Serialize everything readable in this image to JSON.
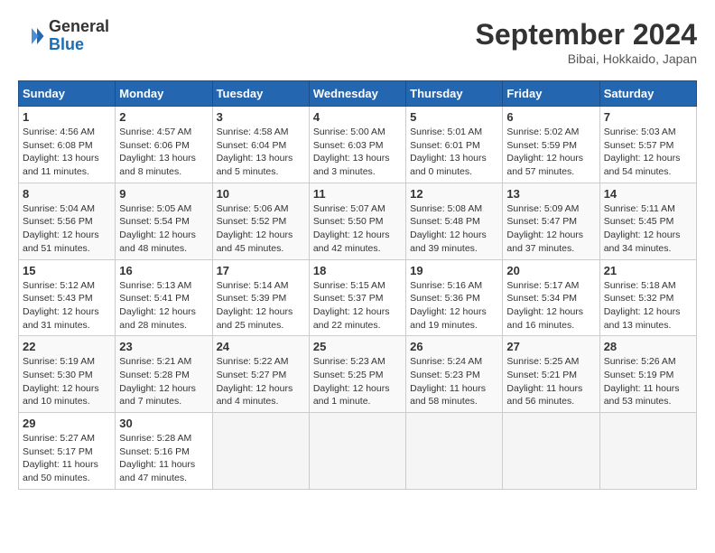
{
  "header": {
    "logo_text_general": "General",
    "logo_text_blue": "Blue",
    "month": "September 2024",
    "location": "Bibai, Hokkaido, Japan"
  },
  "days_of_week": [
    "Sunday",
    "Monday",
    "Tuesday",
    "Wednesday",
    "Thursday",
    "Friday",
    "Saturday"
  ],
  "weeks": [
    [
      {
        "day": 1,
        "sunrise": "4:56 AM",
        "sunset": "6:08 PM",
        "daylight": "13 hours and 11 minutes."
      },
      {
        "day": 2,
        "sunrise": "4:57 AM",
        "sunset": "6:06 PM",
        "daylight": "13 hours and 8 minutes."
      },
      {
        "day": 3,
        "sunrise": "4:58 AM",
        "sunset": "6:04 PM",
        "daylight": "13 hours and 5 minutes."
      },
      {
        "day": 4,
        "sunrise": "5:00 AM",
        "sunset": "6:03 PM",
        "daylight": "13 hours and 3 minutes."
      },
      {
        "day": 5,
        "sunrise": "5:01 AM",
        "sunset": "6:01 PM",
        "daylight": "13 hours and 0 minutes."
      },
      {
        "day": 6,
        "sunrise": "5:02 AM",
        "sunset": "5:59 PM",
        "daylight": "12 hours and 57 minutes."
      },
      {
        "day": 7,
        "sunrise": "5:03 AM",
        "sunset": "5:57 PM",
        "daylight": "12 hours and 54 minutes."
      }
    ],
    [
      {
        "day": 8,
        "sunrise": "5:04 AM",
        "sunset": "5:56 PM",
        "daylight": "12 hours and 51 minutes."
      },
      {
        "day": 9,
        "sunrise": "5:05 AM",
        "sunset": "5:54 PM",
        "daylight": "12 hours and 48 minutes."
      },
      {
        "day": 10,
        "sunrise": "5:06 AM",
        "sunset": "5:52 PM",
        "daylight": "12 hours and 45 minutes."
      },
      {
        "day": 11,
        "sunrise": "5:07 AM",
        "sunset": "5:50 PM",
        "daylight": "12 hours and 42 minutes."
      },
      {
        "day": 12,
        "sunrise": "5:08 AM",
        "sunset": "5:48 PM",
        "daylight": "12 hours and 39 minutes."
      },
      {
        "day": 13,
        "sunrise": "5:09 AM",
        "sunset": "5:47 PM",
        "daylight": "12 hours and 37 minutes."
      },
      {
        "day": 14,
        "sunrise": "5:11 AM",
        "sunset": "5:45 PM",
        "daylight": "12 hours and 34 minutes."
      }
    ],
    [
      {
        "day": 15,
        "sunrise": "5:12 AM",
        "sunset": "5:43 PM",
        "daylight": "12 hours and 31 minutes."
      },
      {
        "day": 16,
        "sunrise": "5:13 AM",
        "sunset": "5:41 PM",
        "daylight": "12 hours and 28 minutes."
      },
      {
        "day": 17,
        "sunrise": "5:14 AM",
        "sunset": "5:39 PM",
        "daylight": "12 hours and 25 minutes."
      },
      {
        "day": 18,
        "sunrise": "5:15 AM",
        "sunset": "5:37 PM",
        "daylight": "12 hours and 22 minutes."
      },
      {
        "day": 19,
        "sunrise": "5:16 AM",
        "sunset": "5:36 PM",
        "daylight": "12 hours and 19 minutes."
      },
      {
        "day": 20,
        "sunrise": "5:17 AM",
        "sunset": "5:34 PM",
        "daylight": "12 hours and 16 minutes."
      },
      {
        "day": 21,
        "sunrise": "5:18 AM",
        "sunset": "5:32 PM",
        "daylight": "12 hours and 13 minutes."
      }
    ],
    [
      {
        "day": 22,
        "sunrise": "5:19 AM",
        "sunset": "5:30 PM",
        "daylight": "12 hours and 10 minutes."
      },
      {
        "day": 23,
        "sunrise": "5:21 AM",
        "sunset": "5:28 PM",
        "daylight": "12 hours and 7 minutes."
      },
      {
        "day": 24,
        "sunrise": "5:22 AM",
        "sunset": "5:27 PM",
        "daylight": "12 hours and 4 minutes."
      },
      {
        "day": 25,
        "sunrise": "5:23 AM",
        "sunset": "5:25 PM",
        "daylight": "12 hours and 1 minute."
      },
      {
        "day": 26,
        "sunrise": "5:24 AM",
        "sunset": "5:23 PM",
        "daylight": "11 hours and 58 minutes."
      },
      {
        "day": 27,
        "sunrise": "5:25 AM",
        "sunset": "5:21 PM",
        "daylight": "11 hours and 56 minutes."
      },
      {
        "day": 28,
        "sunrise": "5:26 AM",
        "sunset": "5:19 PM",
        "daylight": "11 hours and 53 minutes."
      }
    ],
    [
      {
        "day": 29,
        "sunrise": "5:27 AM",
        "sunset": "5:17 PM",
        "daylight": "11 hours and 50 minutes."
      },
      {
        "day": 30,
        "sunrise": "5:28 AM",
        "sunset": "5:16 PM",
        "daylight": "11 hours and 47 minutes."
      },
      null,
      null,
      null,
      null,
      null
    ]
  ]
}
